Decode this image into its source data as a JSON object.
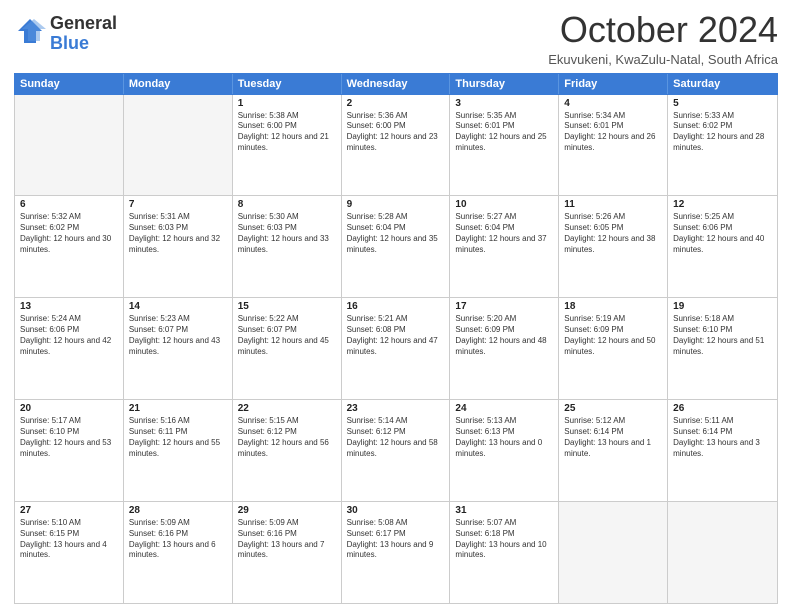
{
  "logo": {
    "general": "General",
    "blue": "Blue"
  },
  "title": "October 2024",
  "location": "Ekuvukeni, KwaZulu-Natal, South Africa",
  "header_days": [
    "Sunday",
    "Monday",
    "Tuesday",
    "Wednesday",
    "Thursday",
    "Friday",
    "Saturday"
  ],
  "weeks": [
    [
      {
        "day": "",
        "sunrise": "",
        "sunset": "",
        "daylight": ""
      },
      {
        "day": "",
        "sunrise": "",
        "sunset": "",
        "daylight": ""
      },
      {
        "day": "1",
        "sunrise": "Sunrise: 5:38 AM",
        "sunset": "Sunset: 6:00 PM",
        "daylight": "Daylight: 12 hours and 21 minutes."
      },
      {
        "day": "2",
        "sunrise": "Sunrise: 5:36 AM",
        "sunset": "Sunset: 6:00 PM",
        "daylight": "Daylight: 12 hours and 23 minutes."
      },
      {
        "day": "3",
        "sunrise": "Sunrise: 5:35 AM",
        "sunset": "Sunset: 6:01 PM",
        "daylight": "Daylight: 12 hours and 25 minutes."
      },
      {
        "day": "4",
        "sunrise": "Sunrise: 5:34 AM",
        "sunset": "Sunset: 6:01 PM",
        "daylight": "Daylight: 12 hours and 26 minutes."
      },
      {
        "day": "5",
        "sunrise": "Sunrise: 5:33 AM",
        "sunset": "Sunset: 6:02 PM",
        "daylight": "Daylight: 12 hours and 28 minutes."
      }
    ],
    [
      {
        "day": "6",
        "sunrise": "Sunrise: 5:32 AM",
        "sunset": "Sunset: 6:02 PM",
        "daylight": "Daylight: 12 hours and 30 minutes."
      },
      {
        "day": "7",
        "sunrise": "Sunrise: 5:31 AM",
        "sunset": "Sunset: 6:03 PM",
        "daylight": "Daylight: 12 hours and 32 minutes."
      },
      {
        "day": "8",
        "sunrise": "Sunrise: 5:30 AM",
        "sunset": "Sunset: 6:03 PM",
        "daylight": "Daylight: 12 hours and 33 minutes."
      },
      {
        "day": "9",
        "sunrise": "Sunrise: 5:28 AM",
        "sunset": "Sunset: 6:04 PM",
        "daylight": "Daylight: 12 hours and 35 minutes."
      },
      {
        "day": "10",
        "sunrise": "Sunrise: 5:27 AM",
        "sunset": "Sunset: 6:04 PM",
        "daylight": "Daylight: 12 hours and 37 minutes."
      },
      {
        "day": "11",
        "sunrise": "Sunrise: 5:26 AM",
        "sunset": "Sunset: 6:05 PM",
        "daylight": "Daylight: 12 hours and 38 minutes."
      },
      {
        "day": "12",
        "sunrise": "Sunrise: 5:25 AM",
        "sunset": "Sunset: 6:06 PM",
        "daylight": "Daylight: 12 hours and 40 minutes."
      }
    ],
    [
      {
        "day": "13",
        "sunrise": "Sunrise: 5:24 AM",
        "sunset": "Sunset: 6:06 PM",
        "daylight": "Daylight: 12 hours and 42 minutes."
      },
      {
        "day": "14",
        "sunrise": "Sunrise: 5:23 AM",
        "sunset": "Sunset: 6:07 PM",
        "daylight": "Daylight: 12 hours and 43 minutes."
      },
      {
        "day": "15",
        "sunrise": "Sunrise: 5:22 AM",
        "sunset": "Sunset: 6:07 PM",
        "daylight": "Daylight: 12 hours and 45 minutes."
      },
      {
        "day": "16",
        "sunrise": "Sunrise: 5:21 AM",
        "sunset": "Sunset: 6:08 PM",
        "daylight": "Daylight: 12 hours and 47 minutes."
      },
      {
        "day": "17",
        "sunrise": "Sunrise: 5:20 AM",
        "sunset": "Sunset: 6:09 PM",
        "daylight": "Daylight: 12 hours and 48 minutes."
      },
      {
        "day": "18",
        "sunrise": "Sunrise: 5:19 AM",
        "sunset": "Sunset: 6:09 PM",
        "daylight": "Daylight: 12 hours and 50 minutes."
      },
      {
        "day": "19",
        "sunrise": "Sunrise: 5:18 AM",
        "sunset": "Sunset: 6:10 PM",
        "daylight": "Daylight: 12 hours and 51 minutes."
      }
    ],
    [
      {
        "day": "20",
        "sunrise": "Sunrise: 5:17 AM",
        "sunset": "Sunset: 6:10 PM",
        "daylight": "Daylight: 12 hours and 53 minutes."
      },
      {
        "day": "21",
        "sunrise": "Sunrise: 5:16 AM",
        "sunset": "Sunset: 6:11 PM",
        "daylight": "Daylight: 12 hours and 55 minutes."
      },
      {
        "day": "22",
        "sunrise": "Sunrise: 5:15 AM",
        "sunset": "Sunset: 6:12 PM",
        "daylight": "Daylight: 12 hours and 56 minutes."
      },
      {
        "day": "23",
        "sunrise": "Sunrise: 5:14 AM",
        "sunset": "Sunset: 6:12 PM",
        "daylight": "Daylight: 12 hours and 58 minutes."
      },
      {
        "day": "24",
        "sunrise": "Sunrise: 5:13 AM",
        "sunset": "Sunset: 6:13 PM",
        "daylight": "Daylight: 13 hours and 0 minutes."
      },
      {
        "day": "25",
        "sunrise": "Sunrise: 5:12 AM",
        "sunset": "Sunset: 6:14 PM",
        "daylight": "Daylight: 13 hours and 1 minute."
      },
      {
        "day": "26",
        "sunrise": "Sunrise: 5:11 AM",
        "sunset": "Sunset: 6:14 PM",
        "daylight": "Daylight: 13 hours and 3 minutes."
      }
    ],
    [
      {
        "day": "27",
        "sunrise": "Sunrise: 5:10 AM",
        "sunset": "Sunset: 6:15 PM",
        "daylight": "Daylight: 13 hours and 4 minutes."
      },
      {
        "day": "28",
        "sunrise": "Sunrise: 5:09 AM",
        "sunset": "Sunset: 6:16 PM",
        "daylight": "Daylight: 13 hours and 6 minutes."
      },
      {
        "day": "29",
        "sunrise": "Sunrise: 5:09 AM",
        "sunset": "Sunset: 6:16 PM",
        "daylight": "Daylight: 13 hours and 7 minutes."
      },
      {
        "day": "30",
        "sunrise": "Sunrise: 5:08 AM",
        "sunset": "Sunset: 6:17 PM",
        "daylight": "Daylight: 13 hours and 9 minutes."
      },
      {
        "day": "31",
        "sunrise": "Sunrise: 5:07 AM",
        "sunset": "Sunset: 6:18 PM",
        "daylight": "Daylight: 13 hours and 10 minutes."
      },
      {
        "day": "",
        "sunrise": "",
        "sunset": "",
        "daylight": ""
      },
      {
        "day": "",
        "sunrise": "",
        "sunset": "",
        "daylight": ""
      }
    ]
  ]
}
